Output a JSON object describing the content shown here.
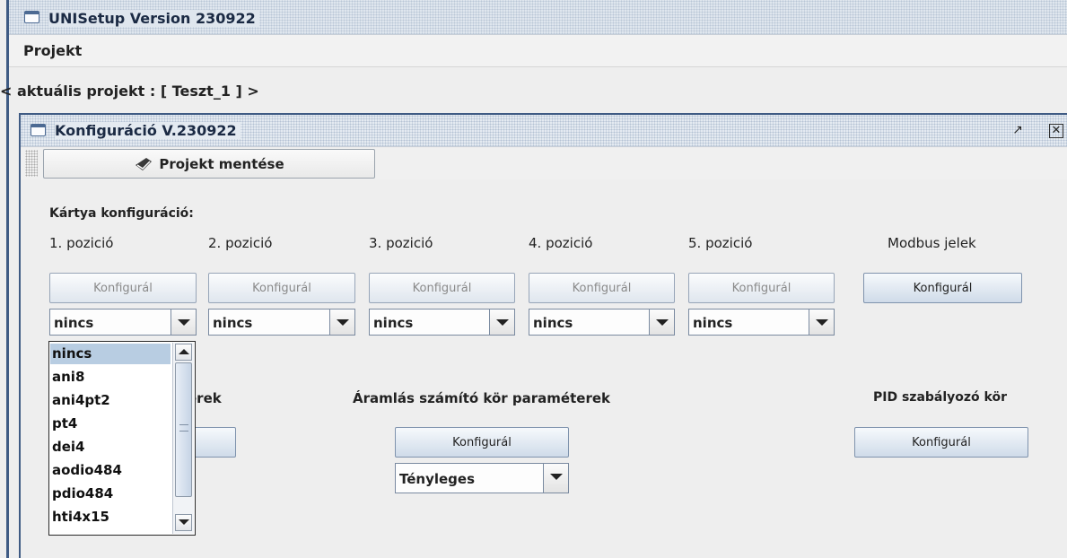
{
  "app": {
    "title": "UNISetup Version 230922"
  },
  "menu": {
    "items": [
      {
        "label": "Projekt"
      }
    ]
  },
  "project": {
    "line": "< aktuális projekt : [ Teszt_1 ] >"
  },
  "inner": {
    "title": "Konfiguráció V.230922",
    "save_label": "Projekt mentése",
    "card_config_label": "Kártya konfiguráció:",
    "positions": [
      {
        "label": "1. pozició",
        "button": "Konfigurál",
        "value": "nincs"
      },
      {
        "label": "2. pozició",
        "button": "Konfigurál",
        "value": "nincs"
      },
      {
        "label": "3. pozició",
        "button": "Konfigurál",
        "value": "nincs"
      },
      {
        "label": "4. pozició",
        "button": "Konfigurál",
        "value": "nincs"
      },
      {
        "label": "5. pozició",
        "button": "Konfigurál",
        "value": "nincs"
      }
    ],
    "modbus": {
      "label": "Modbus jelek",
      "button": "Konfigurál"
    },
    "partial_label": "erek",
    "flow": {
      "label": "Áramlás számító kör paraméterek",
      "button": "Konfigurál",
      "value": "Tényleges"
    },
    "pid": {
      "label": "PID szabályozó kör",
      "button": "Konfigurál"
    },
    "dropdown": {
      "options": [
        "nincs",
        "ani8",
        "ani4pt2",
        "pt4",
        "dei4",
        "aodio484",
        "pdio484",
        "hti4x15"
      ],
      "selected": "nincs"
    }
  }
}
